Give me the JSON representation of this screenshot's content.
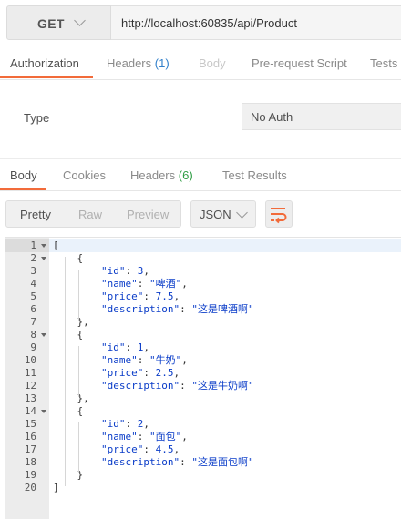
{
  "request": {
    "method": "GET",
    "url": "http://localhost:60835/api/Product"
  },
  "request_tabs": [
    {
      "label": "Authorization",
      "count": ""
    },
    {
      "label": "Headers",
      "count": "(1)"
    },
    {
      "label": "Body",
      "count": ""
    },
    {
      "label": "Pre-request Script",
      "count": ""
    },
    {
      "label": "Tests",
      "count": ""
    }
  ],
  "auth": {
    "type_label": "Type",
    "type_value": "No Auth"
  },
  "response_tabs": [
    {
      "label": "Body",
      "count": ""
    },
    {
      "label": "Cookies",
      "count": ""
    },
    {
      "label": "Headers",
      "count": "(6)"
    },
    {
      "label": "Test Results",
      "count": ""
    }
  ],
  "view_modes": [
    "Pretty",
    "Raw",
    "Preview"
  ],
  "format": "JSON",
  "icons": {
    "method_dropdown": "chevron-down-icon",
    "format_dropdown": "chevron-down-icon",
    "wrap": "wrap-lines-icon"
  },
  "colors": {
    "accent": "#f26b3a",
    "count_blue": "#2f7fcb",
    "count_green": "#2f9d44",
    "code_value": "#0a3cc8"
  },
  "code_lines": [
    {
      "n": "1",
      "text": "["
    },
    {
      "n": "2",
      "text": "    {"
    },
    {
      "n": "3",
      "text": "        \"id\": 3,"
    },
    {
      "n": "4",
      "text": "        \"name\": \"啤酒\","
    },
    {
      "n": "5",
      "text": "        \"price\": 7.5,"
    },
    {
      "n": "6",
      "text": "        \"description\": \"这是啤酒啊\""
    },
    {
      "n": "7",
      "text": "    },"
    },
    {
      "n": "8",
      "text": "    {"
    },
    {
      "n": "9",
      "text": "        \"id\": 1,"
    },
    {
      "n": "10",
      "text": "        \"name\": \"牛奶\","
    },
    {
      "n": "11",
      "text": "        \"price\": 2.5,"
    },
    {
      "n": "12",
      "text": "        \"description\": \"这是牛奶啊\""
    },
    {
      "n": "13",
      "text": "    },"
    },
    {
      "n": "14",
      "text": "    {"
    },
    {
      "n": "15",
      "text": "        \"id\": 2,"
    },
    {
      "n": "16",
      "text": "        \"name\": \"面包\","
    },
    {
      "n": "17",
      "text": "        \"price\": 4.5,"
    },
    {
      "n": "18",
      "text": "        \"description\": \"这是面包啊\""
    },
    {
      "n": "19",
      "text": "    }"
    },
    {
      "n": "20",
      "text": "]"
    }
  ]
}
